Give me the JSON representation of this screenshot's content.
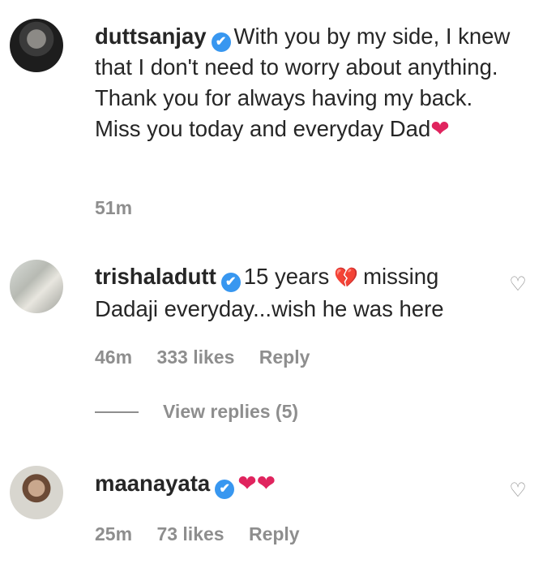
{
  "comments": [
    {
      "username": "duttsanjay",
      "text": "With you by my side, I knew that I don't need to worry about anything. Thank you for always having my back. Miss you today and everyday Dad",
      "emoji": "❤",
      "time": "51m"
    },
    {
      "username": "trishaladutt",
      "text_before": "15 years",
      "emoji": "💔",
      "text_after": "missing Dadaji everyday...wish he was here",
      "time": "46m",
      "likes": "333 likes",
      "reply": "Reply",
      "view_replies": "View replies (5)"
    },
    {
      "username": "maanayata",
      "emoji": "❤❤",
      "time": "25m",
      "likes": "73 likes",
      "reply": "Reply"
    }
  ],
  "icons": {
    "verified": "✔",
    "like": "♡"
  },
  "colors": {
    "verified": "#3897f0",
    "meta": "#8e8e8e",
    "heart": "#e0245e"
  }
}
